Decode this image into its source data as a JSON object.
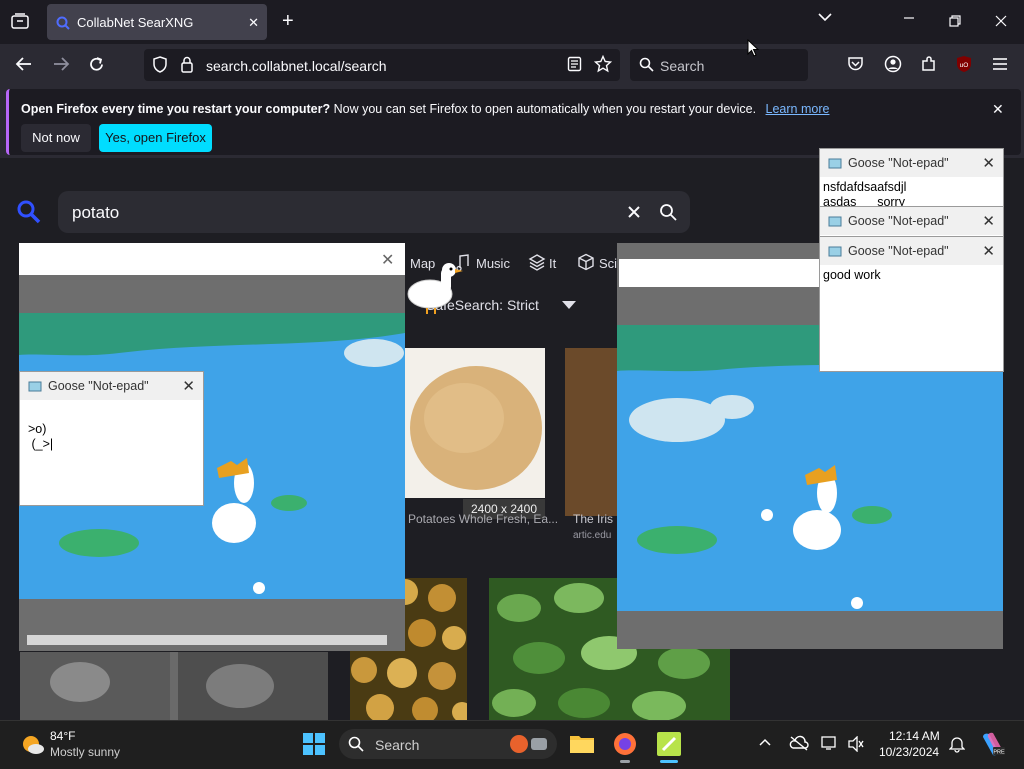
{
  "browser": {
    "tab_title": "CollabNet SearXNG",
    "url": "search.collabnet.local/search",
    "search_placeholder": "Search"
  },
  "notification": {
    "bold_text": "Open Firefox every time you restart your computer?",
    "text": "Now you can set Firefox to open automatically when you restart your device.",
    "link": "Learn more",
    "not_now": "Not now",
    "yes_open": "Yes, open Firefox"
  },
  "searx": {
    "query": "potato",
    "categories": {
      "map": "Map",
      "music": "Music",
      "it": "It",
      "sci": "Sci"
    },
    "safesearch": "SafeSearch: Strict",
    "results": [
      {
        "dimensions": "2400 x 2400",
        "caption": "Potatoes Whole Fresh, Ea..."
      },
      {
        "caption": "The Iris",
        "source": "artic.edu"
      }
    ]
  },
  "goose_windows": [
    {
      "title": "Goose \"Not-epad\"",
      "body": "nsfdafdsaafsdjl\nasdas      sorry"
    },
    {
      "title": "Goose \"Not-epad\"",
      "body": ""
    },
    {
      "title": "Goose \"Not-epad\"",
      "body": "good work"
    },
    {
      "title": "Goose \"Not-epad\"",
      "body": ">o)\n (_>|"
    }
  ],
  "taskbar": {
    "temperature": "84°F",
    "weather": "Mostly sunny",
    "search": "Search",
    "time": "12:14 AM",
    "date": "10/23/2024"
  },
  "colors": {
    "accent": "#00ddff",
    "frame": "#1c1b22",
    "toolbar": "#2b2a33",
    "link": "#7ab8ff"
  }
}
